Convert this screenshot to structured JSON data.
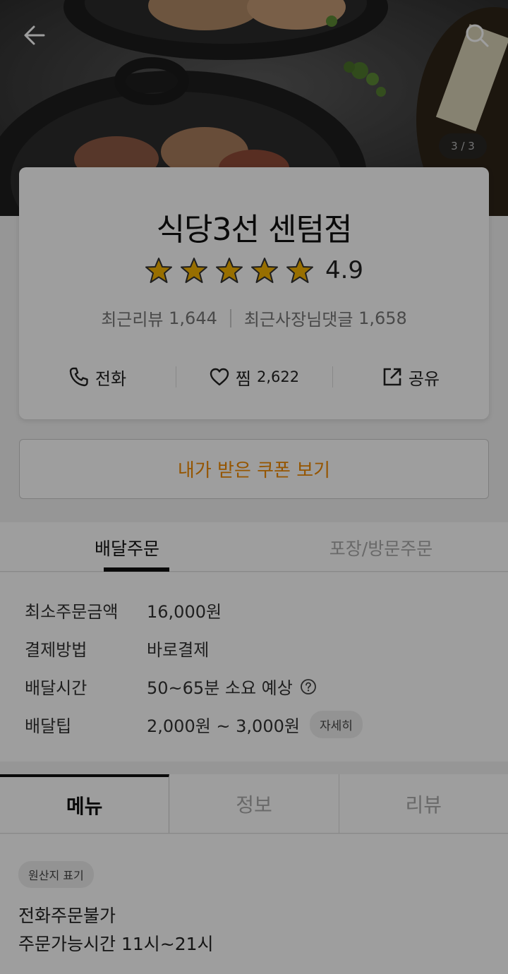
{
  "hero": {
    "counter": "3 / 3"
  },
  "store": {
    "name": "식당3선 센텀점",
    "rating": "4.9",
    "stars": 5,
    "recent_review_label": "최근리뷰",
    "recent_review_count": "1,644",
    "owner_reply_label": "최근사장님댓글",
    "owner_reply_count": "1,658"
  },
  "actions": {
    "call": "전화",
    "like": "찜",
    "like_count": "2,622",
    "share": "공유"
  },
  "coupon": {
    "label": "내가 받은 쿠폰 보기"
  },
  "order_tabs": [
    "배달주문",
    "포장/방문주문"
  ],
  "details": [
    {
      "label": "최소주문금액",
      "value": "16,000원"
    },
    {
      "label": "결제방법",
      "value": "바로결제"
    },
    {
      "label": "배달시간",
      "value": "50~65분 소요 예상"
    },
    {
      "label": "배달팁",
      "value": "2,000원 ~ 3,000원",
      "button": "자세히"
    }
  ],
  "menu_tabs": [
    "메뉴",
    "정보",
    "리뷰"
  ],
  "notes": {
    "origin_badge": "원산지 표기",
    "lines": [
      "전화주문불가",
      "주문가능시간 11시~21시"
    ]
  },
  "colors": {
    "accent": "#f08a00",
    "star": "#f5b400"
  }
}
